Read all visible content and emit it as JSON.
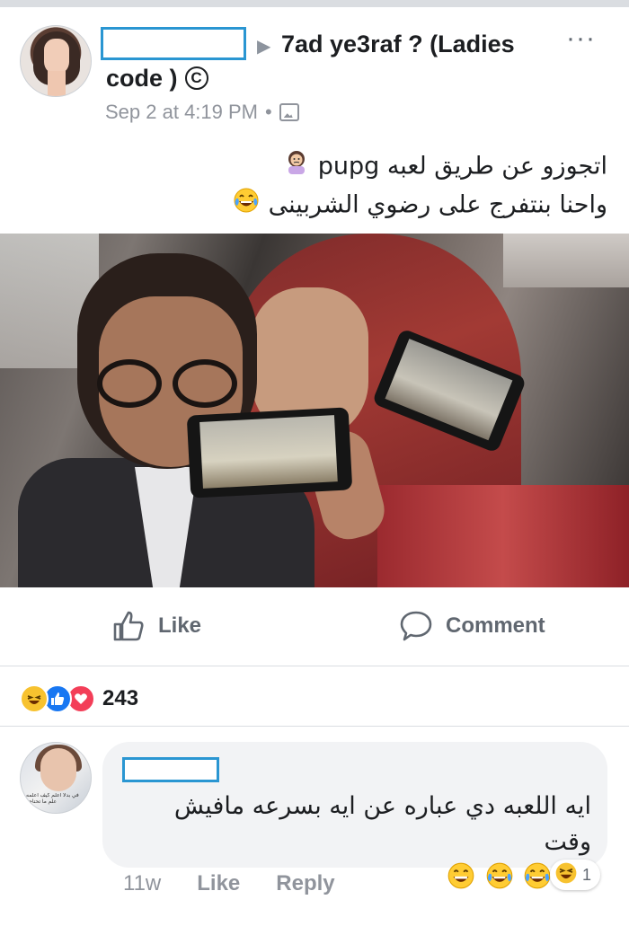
{
  "post": {
    "group_name_line1": "7ad ye3raf ? (Ladies",
    "group_name_line2": "code )",
    "copyright_symbol": "C",
    "more_label": "···",
    "arrow": "▶",
    "timestamp": "Sep 2 at 4:19 PM",
    "separator": "•",
    "privacy_icon": "photo-icon",
    "text_line1": "اتجوزو عن طريق لعبه pupg",
    "text_line2": "واحنا بنتفرج على رضوي الشربينى",
    "emoji_line1": "woman-shrugging-emoji",
    "emoji_line2": "tears-of-joy-emoji"
  },
  "actions": {
    "like_label": "Like",
    "comment_label": "Comment"
  },
  "reactions": {
    "icons": [
      "haha-icon",
      "like-icon",
      "love-icon"
    ],
    "count": "243"
  },
  "comment": {
    "text": "ايه اللعبه دي عباره عن ايه بسرعه مافيش وقت",
    "emojis": [
      "grinning-emoji",
      "tears-of-joy-emoji",
      "tears-of-joy-emoji",
      "tears-of-joy-emoji"
    ],
    "avatar_caption": "في بدلا اعلم كيف اعلمه علم ما تحتاجه",
    "time": "11w",
    "like_label": "Like",
    "reply_label": "Reply",
    "reaction_count": "1"
  },
  "colors": {
    "accent": "#1877f2",
    "redaction_border": "#2a96d2",
    "secondary_text": "#90949c",
    "bubble": "#f2f3f5"
  }
}
